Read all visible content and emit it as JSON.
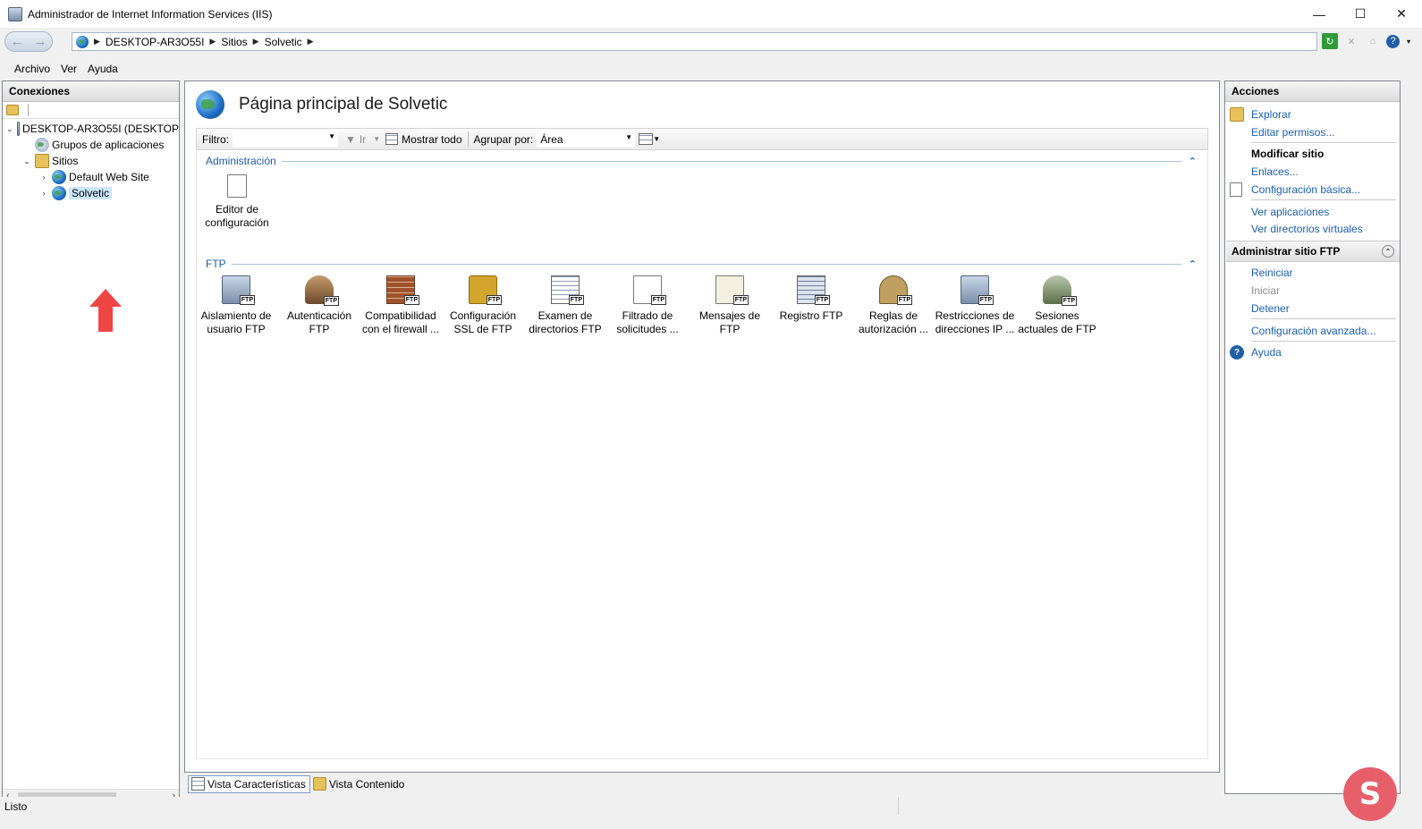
{
  "window": {
    "title": "Administrador de Internet Information Services (IIS)",
    "controls": {
      "minimize": "—",
      "maximize": "☐",
      "close": "✕"
    }
  },
  "address": {
    "crumbs": [
      "DESKTOP-AR3O55I",
      "Sitios",
      "Solvetic"
    ]
  },
  "menu": [
    "Archivo",
    "Ver",
    "Ayuda"
  ],
  "connections": {
    "header": "Conexiones",
    "tree": [
      {
        "label": "DESKTOP-AR3O55I (DESKTOP",
        "level": 0,
        "toggle": "⌄",
        "icon": "server-icon"
      },
      {
        "label": "Grupos de aplicaciones",
        "level": 1,
        "toggle": "",
        "icon": "app-pools-icon"
      },
      {
        "label": "Sitios",
        "level": 1,
        "toggle": "⌄",
        "icon": "sites-folder-icon"
      },
      {
        "label": "Default Web Site",
        "level": 2,
        "toggle": "›",
        "icon": "website-icon"
      },
      {
        "label": "Solvetic",
        "level": 2,
        "toggle": "›",
        "icon": "globe-icon",
        "selected": true
      }
    ]
  },
  "main": {
    "title": "Página principal de Solvetic",
    "filter": {
      "label": "Filtro:",
      "go": "Ir",
      "show_all": "Mostrar todo",
      "group_by_label": "Agrupar por:",
      "group_by_value": "Área"
    },
    "groups": [
      {
        "name": "Administración",
        "features": [
          {
            "label": "Editor de configuración",
            "icon": "config-editor-icon"
          }
        ]
      },
      {
        "name": "FTP",
        "features": [
          {
            "label": "Aislamiento de usuario FTP",
            "icon": "ftp-user-isolation-icon"
          },
          {
            "label": "Autenticación FTP",
            "icon": "ftp-authentication-icon"
          },
          {
            "label": "Compatibilidad con el firewall ...",
            "icon": "ftp-firewall-icon"
          },
          {
            "label": "Configuración SSL de FTP",
            "icon": "ftp-ssl-icon"
          },
          {
            "label": "Examen de directorios FTP",
            "icon": "ftp-directory-browsing-icon"
          },
          {
            "label": "Filtrado de solicitudes ...",
            "icon": "ftp-request-filtering-icon"
          },
          {
            "label": "Mensajes de FTP",
            "icon": "ftp-messages-icon"
          },
          {
            "label": "Registro FTP",
            "icon": "ftp-logging-icon"
          },
          {
            "label": "Reglas de autorización ...",
            "icon": "ftp-authorization-icon"
          },
          {
            "label": "Restricciones de direcciones IP ...",
            "icon": "ftp-ip-restrictions-icon"
          },
          {
            "label": "Sesiones actuales de FTP",
            "icon": "ftp-sessions-icon"
          }
        ]
      }
    ],
    "ftp_badge": "FTP",
    "view_tabs": [
      "Vista Características",
      "Vista Contenido"
    ]
  },
  "actions": {
    "header": "Acciones",
    "items": {
      "explorar": "Explorar",
      "editar_permisos": "Editar permisos...",
      "modificar_sitio": "Modificar sitio",
      "enlaces": "Enlaces...",
      "config_basica": "Configuración básica...",
      "ver_aplicaciones": "Ver aplicaciones",
      "ver_directorios": "Ver directorios virtuales",
      "administrar_ftp": "Administrar sitio FTP",
      "reiniciar": "Reiniciar",
      "iniciar": "Iniciar",
      "detener": "Detener",
      "config_avanzada": "Configuración avanzada...",
      "ayuda": "Ayuda"
    }
  },
  "status": {
    "text": "Listo"
  },
  "watermark": {
    "glyph": "S"
  },
  "colors": {
    "link": "#1a5fb4",
    "group_header": "#1e5aa5",
    "selection": "#cce8ff",
    "arrow": "#f04545"
  }
}
